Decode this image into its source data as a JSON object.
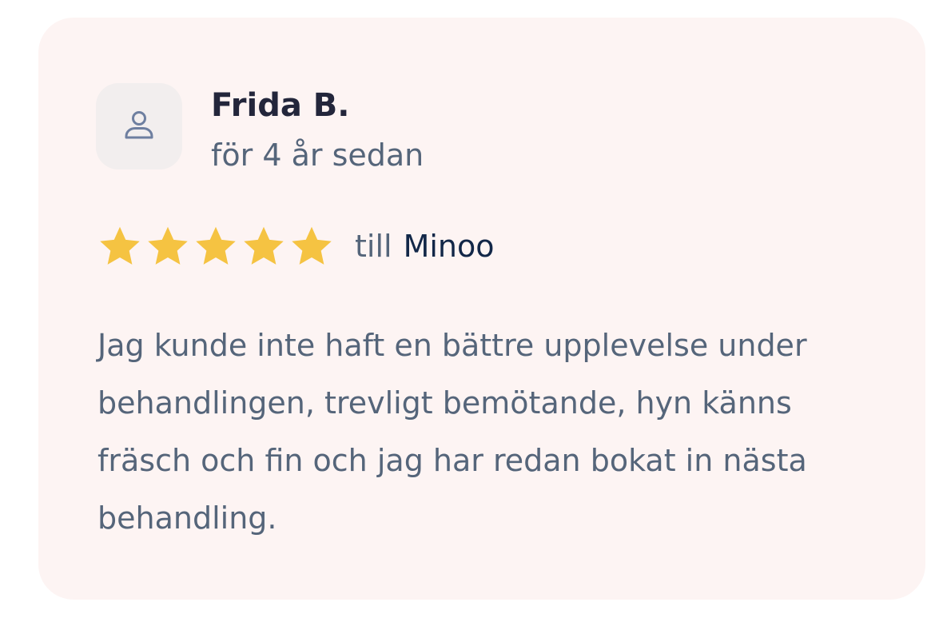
{
  "review": {
    "author": "Frida B.",
    "time_ago": "för 4 år sedan",
    "rating": 5,
    "rating_max": 5,
    "to_label": "till",
    "provider": "Minoo",
    "text": "Jag kunde inte haft en bättre upplevelse under behandlingen, trevligt bemötande, hyn känns fräsch och fin och jag har redan bokat in nästa behandling."
  },
  "icons": {
    "avatar": "user-icon",
    "star": "star-icon"
  },
  "colors": {
    "card_background": "#fdf4f3",
    "avatar_background": "#f2eeee",
    "star": "#f5c342",
    "name": "#23263b",
    "muted_text": "#55657a",
    "provider": "#122748",
    "icon_stroke": "#6e7fa0"
  }
}
